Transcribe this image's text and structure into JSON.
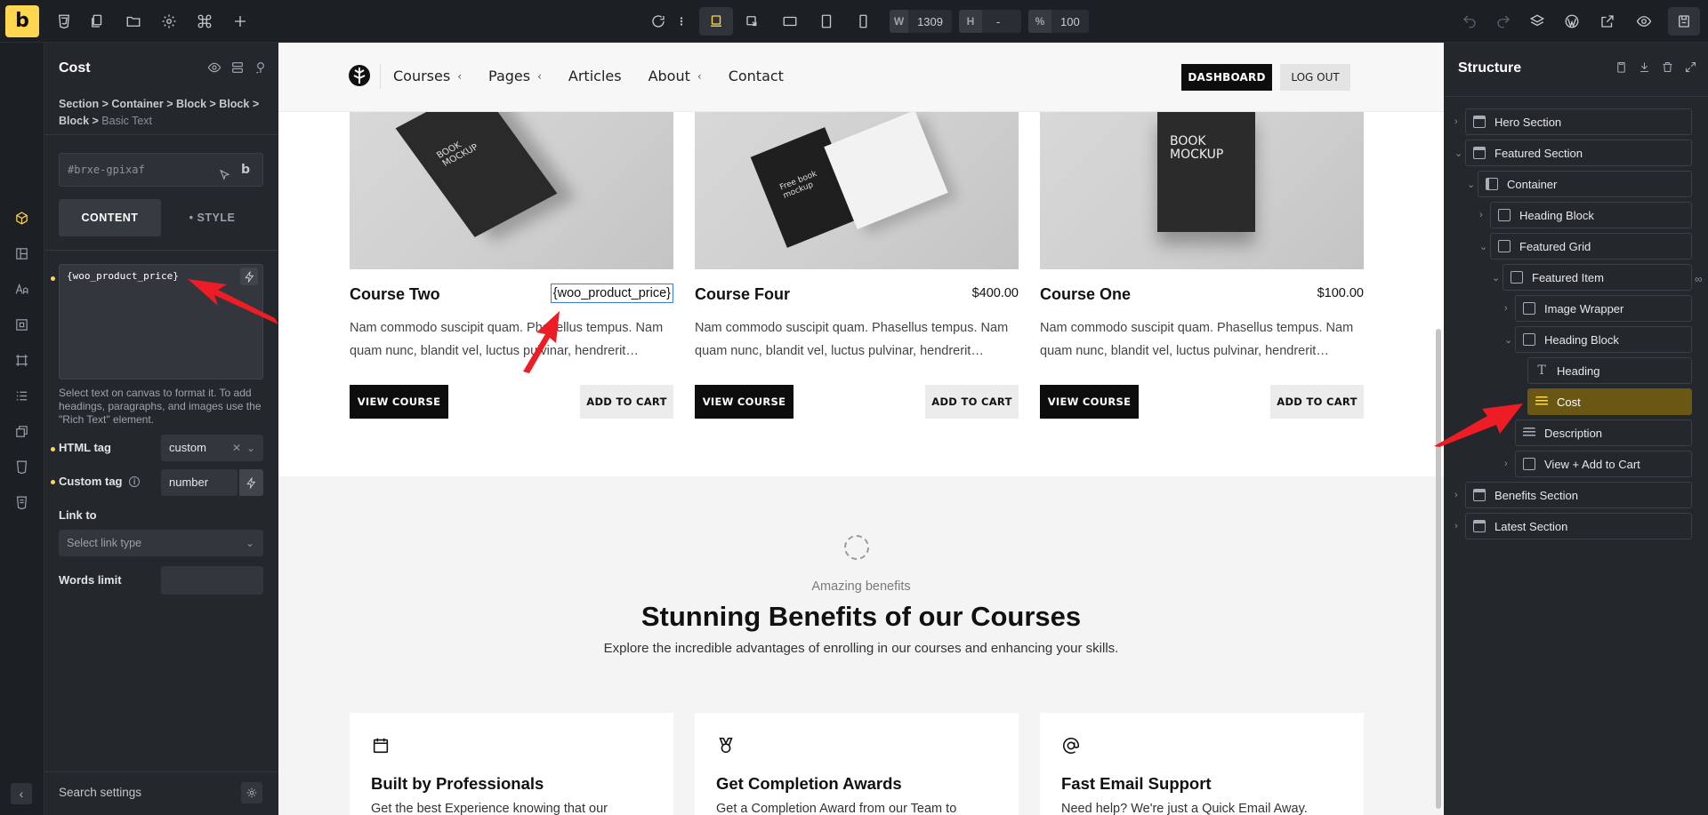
{
  "toolbar": {
    "logo": "b",
    "width_label": "W",
    "width_value": "1309",
    "height_label": "H",
    "height_value": "-",
    "zoom_label": "%",
    "zoom_value": "100"
  },
  "panel": {
    "title": "Cost",
    "breadcrumb": [
      "Section",
      "Container",
      "Block",
      "Block",
      "Block",
      "Basic Text"
    ],
    "crumb_sep": " > ",
    "element_id": "#brxe-gpixaf",
    "id_suffix_icon": "b",
    "tabs": [
      {
        "label": "CONTENT",
        "active": true
      },
      {
        "label": "• STYLE",
        "active": false
      }
    ],
    "text_value": "{woo_product_price}",
    "hint": "Select text on canvas to format it. To add headings, paragraphs, and images use the \"Rich Text\" element.",
    "html_tag_label": "HTML tag",
    "html_tag_value": "custom",
    "custom_tag_label": "Custom tag",
    "custom_tag_value": "number",
    "link_to_label": "Link to",
    "link_placeholder": "Select link type",
    "words_limit_label": "Words limit",
    "words_limit_value": "",
    "search_settings": "Search settings"
  },
  "site": {
    "nav": [
      {
        "label": "Courses",
        "has_chevron": true
      },
      {
        "label": "Pages",
        "has_chevron": true
      },
      {
        "label": "Articles",
        "has_chevron": false
      },
      {
        "label": "About",
        "has_chevron": true
      },
      {
        "label": "Contact",
        "has_chevron": false
      }
    ],
    "dashboard_btn": "DASHBOARD",
    "logout_btn": "LOG OUT",
    "courses": [
      {
        "title": "Course Two",
        "price": "{woo_product_price}",
        "desc": "Nam commodo suscipit quam. Phasellus tempus. Nam quam nunc, blandit vel, luctus pulvinar, hendrerit…",
        "view": "VIEW COURSE",
        "cart": "ADD TO CART",
        "book_text": "BOOK MOCKUP"
      },
      {
        "title": "Course Four",
        "price": "$400.00",
        "desc": "Nam commodo suscipit quam. Phasellus tempus. Nam quam nunc, blandit vel, luctus pulvinar, hendrerit…",
        "view": "VIEW COURSE",
        "cart": "ADD TO CART",
        "book_text": "Free book mockup"
      },
      {
        "title": "Course One",
        "price": "$100.00",
        "desc": "Nam commodo suscipit quam. Phasellus tempus. Nam quam nunc, blandit vel, luctus pulvinar, hendrerit…",
        "view": "VIEW COURSE",
        "cart": "ADD TO CART",
        "book_text": "BOOK MOCKUP"
      }
    ],
    "benefits": {
      "eyebrow": "Amazing benefits",
      "title": "Stunning Benefits of our Courses",
      "subtitle": "Explore the incredible advantages of enrolling in our courses and enhancing your skills.",
      "cards": [
        {
          "icon": "calendar-icon",
          "title": "Built by Professionals",
          "text": "Get the best Experience knowing that our"
        },
        {
          "icon": "medal-icon",
          "title": "Get Completion Awards",
          "text": "Get a Completion Award from our Team to"
        },
        {
          "icon": "at-sign-icon",
          "title": "Fast Email Support",
          "text": "Need help? We're just a Quick Email Away."
        }
      ]
    }
  },
  "structure": {
    "title": "Structure",
    "items": [
      {
        "label": "Hero Section",
        "icon": "section"
      },
      {
        "label": "Featured Section",
        "icon": "section"
      },
      {
        "label": "Container",
        "icon": "container"
      },
      {
        "label": "Heading Block",
        "icon": "block"
      },
      {
        "label": "Featured Grid",
        "icon": "block"
      },
      {
        "label": "Featured Item",
        "icon": "block"
      },
      {
        "label": "Image Wrapper",
        "icon": "block"
      },
      {
        "label": "Heading Block",
        "icon": "block"
      },
      {
        "label": "Heading",
        "icon": "heading"
      },
      {
        "label": "Cost",
        "icon": "text",
        "selected": true
      },
      {
        "label": "Description",
        "icon": "text"
      },
      {
        "label": "View + Add to Cart",
        "icon": "block"
      },
      {
        "label": "Benefits Section",
        "icon": "section"
      },
      {
        "label": "Latest Section",
        "icon": "section"
      }
    ]
  },
  "colors": {
    "accent": "#ffd64f",
    "selected_row": "#6b5714",
    "annotation_arrow": "#ee1c24"
  }
}
